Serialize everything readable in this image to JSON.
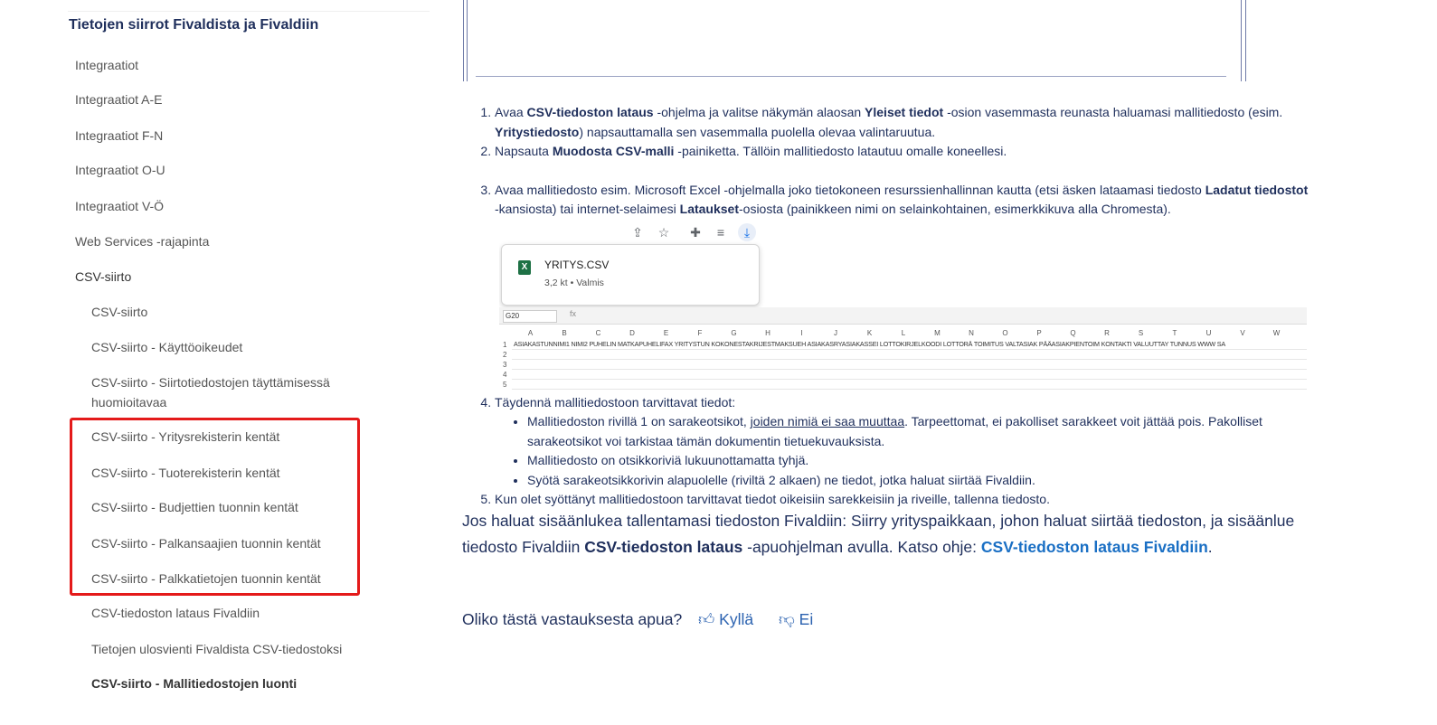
{
  "sidebar": {
    "title": "Tietojen siirrot Fivaldista ja Fivaldiin",
    "items": [
      {
        "label": "Integraatiot"
      },
      {
        "label": "Integraatiot A-E"
      },
      {
        "label": "Integraatiot F-N"
      },
      {
        "label": "Integraatiot O-U"
      },
      {
        "label": "Integraatiot V-Ö"
      },
      {
        "label": "Web Services -rajapinta"
      },
      {
        "label": "CSV-siirto"
      },
      {
        "label": "CSV-siirto"
      },
      {
        "label": "CSV-siirto - Käyttöoikeudet"
      },
      {
        "label": "CSV-siirto - Siirtotiedostojen täyttämisessä huomioitavaa"
      },
      {
        "label": "CSV-siirto - Yritysrekisterin kentät"
      },
      {
        "label": "CSV-siirto - Tuoterekisterin kentät"
      },
      {
        "label": "CSV-siirto - Budjettien tuonnin kentät"
      },
      {
        "label": "CSV-siirto - Palkansaajien tuonnin kentät"
      },
      {
        "label": "CSV-siirto - Palkkatietojen tuonnin kentät"
      },
      {
        "label": "CSV-tiedoston lataus Fivaldiin"
      },
      {
        "label": "Tietojen ulosvienti Fivaldista CSV-tiedostoksi"
      },
      {
        "label": "CSV-siirto - Mallitiedostojen luonti"
      }
    ]
  },
  "steps": {
    "s1": {
      "t1": "Avaa ",
      "b1": "CSV-tiedoston lataus",
      "t2": " -ohjelma ja valitse näkymän alaosan ",
      "b2": "Yleiset tiedot",
      "t3": " -osion vasemmasta reunasta haluamasi mallitiedosto (esim. ",
      "b3": "Yritystiedosto",
      "t4": ") napsauttamalla sen vasemmalla puolella olevaa valintaruutua."
    },
    "s2": {
      "t1": "Napsauta ",
      "b1": "Muodosta CSV-malli",
      "t2": " -painiketta. Tällöin mallitiedosto latautuu omalle koneellesi."
    },
    "s3": {
      "t1": "Avaa mallitiedosto esim. Microsoft Excel -ohjelmalla joko tietokoneen resurssienhallinnan kautta (etsi äsken lataamasi tiedosto ",
      "b1": "Ladatut tiedostot",
      "t2": " -kansiosta) tai internet-selaimesi ",
      "b2": "Lataukset",
      "t3": "-osiosta (painikkeen nimi on selainkohtainen, esimerkkikuva alla Chromesta)."
    },
    "s4": {
      "t1": "Täydennä mallitiedostoon tarvittavat tiedot:",
      "b1a": "Mallitiedoston rivillä 1 on sarakeotsikot, ",
      "b1u": "joiden nimiä ei saa muuttaa",
      "b1b": ". Tarpeettomat, ei pakolliset sarakkeet voit jättää pois. Pakolliset sarakeotsikot voi tarkistaa tämän dokumentin tietuekuvauksista.",
      "b2": "Mallitiedosto on otsikkoriviä lukuunottamatta tyhjä.",
      "b3": "Syötä sarakeotsikkorivin alapuolelle (riviltä 2 alkaen) ne tiedot, jotka haluat siirtää Fivaldiin."
    },
    "s5": {
      "t1": "Kun olet syöttänyt mallitiedostoon tarvittavat tiedot oikeisiin sarekkeisiin ja riveille, tallenna tiedosto."
    }
  },
  "embedded": {
    "file_name": "YRITYS.CSV",
    "file_meta": "3,2 kt • Valmis",
    "cell_ref": "G20",
    "fx": "fx",
    "columns": [
      "A",
      "B",
      "C",
      "D",
      "E",
      "F",
      "G",
      "H",
      "I",
      "J",
      "K",
      "L",
      "M",
      "N",
      "O",
      "P",
      "Q",
      "R",
      "S",
      "T",
      "U",
      "V",
      "W"
    ],
    "rows": [
      "1",
      "2",
      "3",
      "4",
      "5"
    ],
    "header_row": "ASIAKASTUNNIMI1   NIMI2   PUHELIN  MATKAPUHELIFAX   YRITYSTUN KOKONESTAKRIJESTMAKSUEH ASIAKASRYASIAKASSEI LOTTOKIRJELKOODI LOTTORÄ  TOIMITUS VALTASIAK PÄÄASIAKPIENTOIM KONTAKTI VALUUTTAY TUNNUS  WWW     SA"
  },
  "paragraph": {
    "t1": "Jos haluat sisäänlukea tallentamasi tiedoston Fivaldiin: Siirry yrityspaikkaan, johon haluat siirtää tiedoston, ja sisäänlue tiedosto Fivaldiin ",
    "b1": "CSV-tiedoston lataus",
    "t2": " -apuohjelman avulla. Katso ohje: ",
    "link": "CSV-tiedoston lataus Fivaldiin",
    "t3": "."
  },
  "feedback": {
    "question": "Oliko tästä vastauksesta apua?",
    "yes": "Kyllä",
    "no": "Ei"
  },
  "colors": {
    "accent": "#1f2f5c",
    "link": "#1a6fc4",
    "highlight": "#e41a1a"
  },
  "icons": [
    "share-icon",
    "star-icon",
    "extension-icon",
    "media-icon",
    "download-icon",
    "excel-file-icon",
    "thumbs-up-icon",
    "thumbs-down-icon"
  ]
}
